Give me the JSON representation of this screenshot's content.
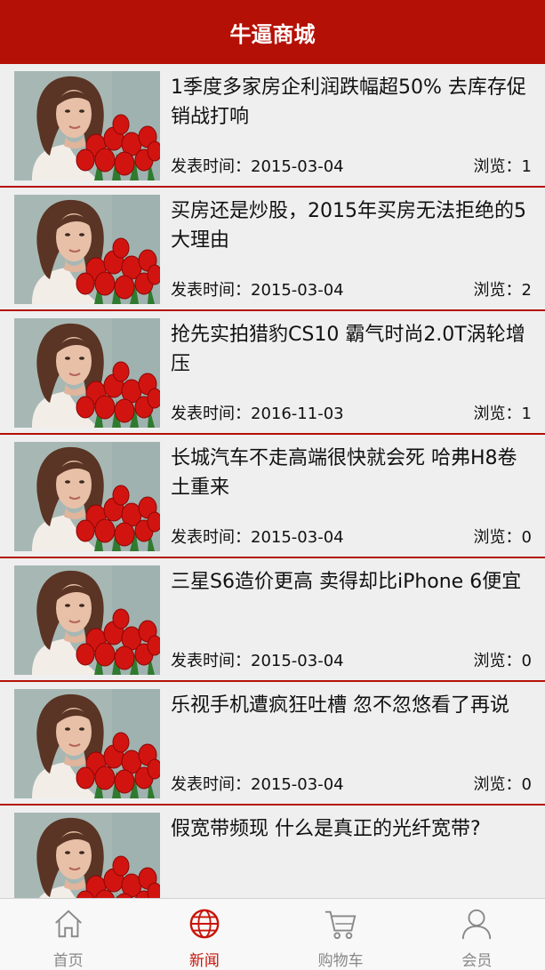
{
  "header": {
    "title": "牛逼商城"
  },
  "articles": [
    {
      "title": "1季度多家房企利润跌幅超50% 去库存促销战打响",
      "date": "发表时间：2015-03-04",
      "views": "浏览：1"
    },
    {
      "title": "买房还是炒股，2015年买房无法拒绝的5大理由",
      "date": "发表时间：2015-03-04",
      "views": "浏览：2"
    },
    {
      "title": "抢先实拍猎豹CS10 霸气时尚2.0T涡轮增压",
      "date": "发表时间：2016-11-03",
      "views": "浏览：1"
    },
    {
      "title": "长城汽车不走高端很快就会死 哈弗H8卷土重来",
      "date": "发表时间：2015-03-04",
      "views": "浏览：0"
    },
    {
      "title": "三星S6造价更高 卖得却比iPhone 6便宜",
      "date": "发表时间：2015-03-04",
      "views": "浏览：0"
    },
    {
      "title": "乐视手机遭疯狂吐槽 忽不忽悠看了再说",
      "date": "发表时间：2015-03-04",
      "views": "浏览：0"
    },
    {
      "title": "假宽带频现 什么是真正的光纤宽带?",
      "date": "",
      "views": ""
    }
  ],
  "tabs": [
    {
      "label": "首页",
      "icon": "home-icon"
    },
    {
      "label": "新闻",
      "icon": "globe-icon",
      "active": true
    },
    {
      "label": "购物车",
      "icon": "cart-icon"
    },
    {
      "label": "会员",
      "icon": "user-icon"
    }
  ],
  "colors": {
    "primary": "#b51005",
    "active_tab": "#c8140a",
    "inactive_tab": "#888888"
  }
}
